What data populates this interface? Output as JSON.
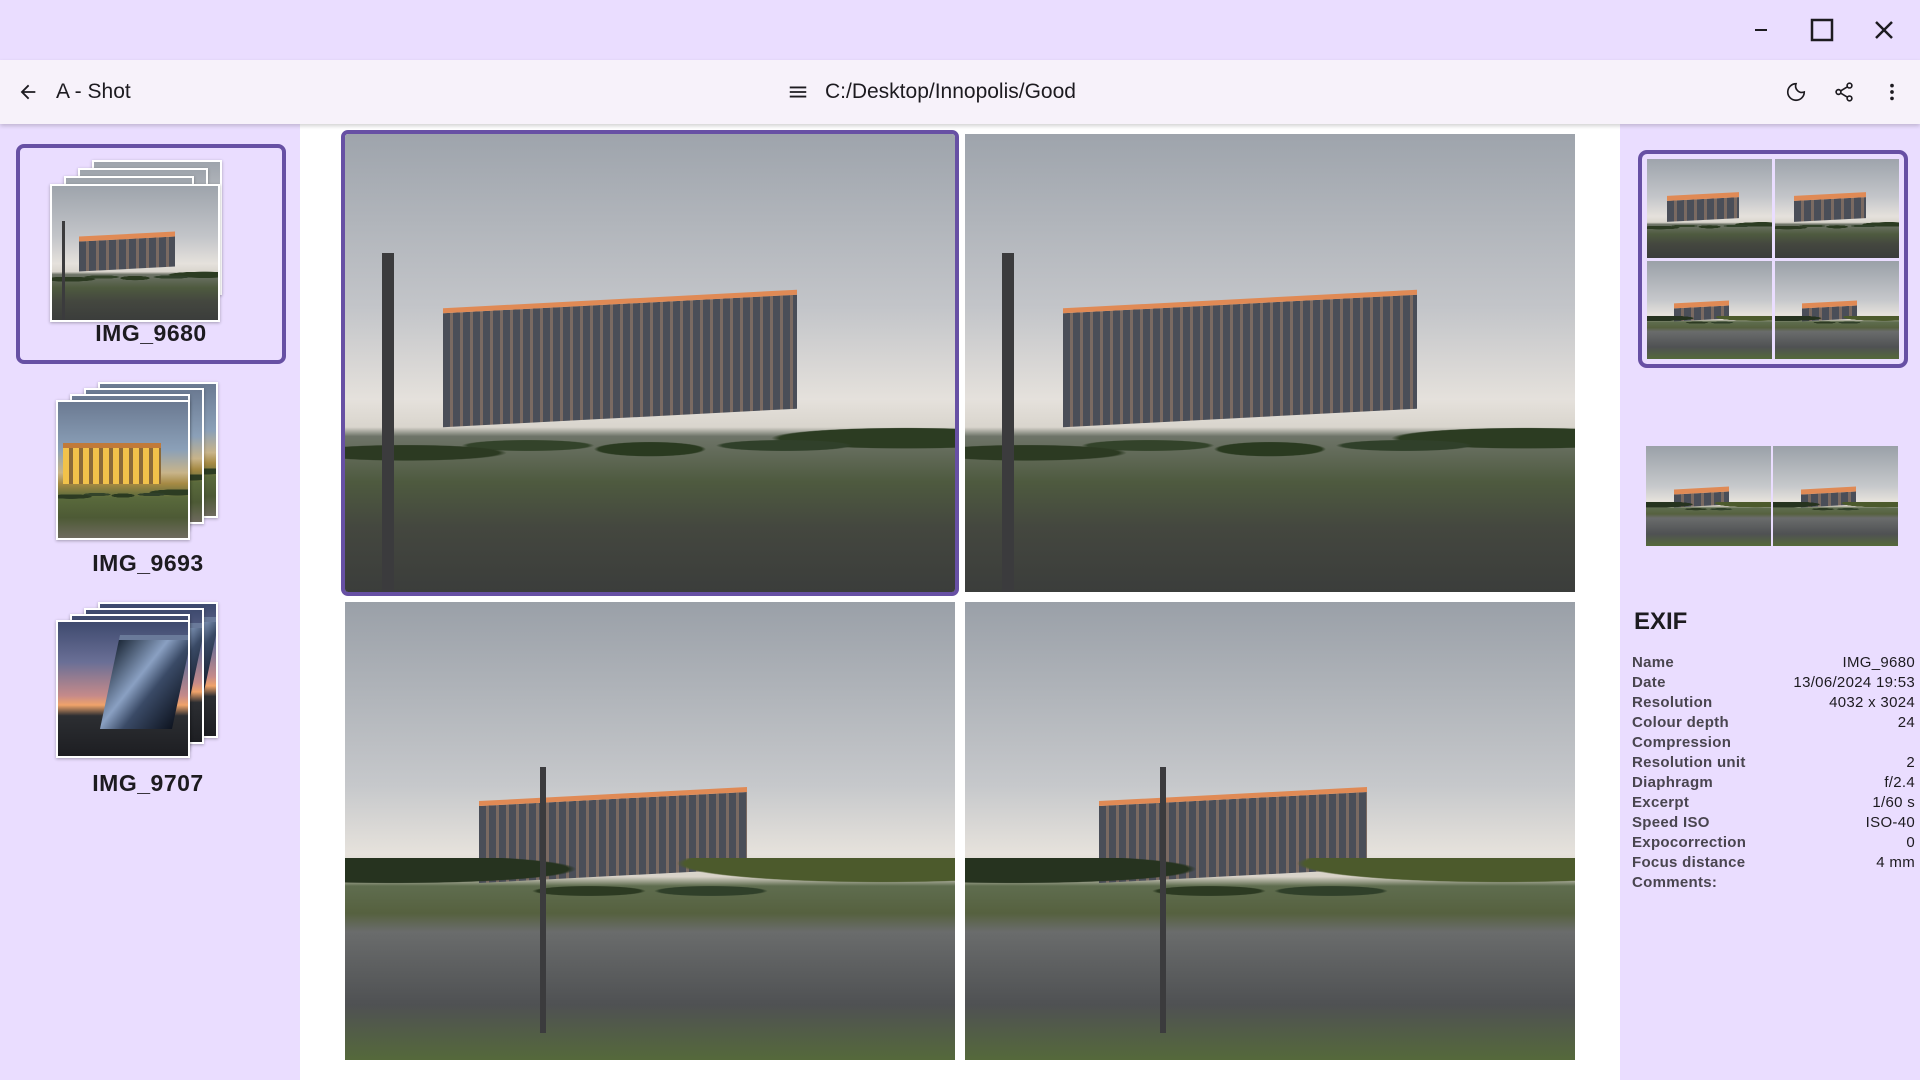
{
  "window": {
    "minimize_icon": "minimize-icon",
    "maximize_icon": "maximize-icon",
    "close_icon": "close-icon"
  },
  "toolbar": {
    "back_icon": "arrow-back-icon",
    "app_title": "A - Shot",
    "menu_icon": "hamburger-menu-icon",
    "path": "C:/Desktop/Innopolis/Good",
    "theme_icon": "dark-mode-moon-icon",
    "share_icon": "share-icon",
    "more_icon": "more-vert-icon"
  },
  "files": [
    {
      "name": "IMG_9680",
      "selected": true
    },
    {
      "name": "IMG_9693",
      "selected": false
    },
    {
      "name": "IMG_9707",
      "selected": false
    }
  ],
  "grid_photos": [
    {
      "scene": "building-front",
      "selected": true
    },
    {
      "scene": "building-front",
      "selected": false
    },
    {
      "scene": "building-road",
      "selected": false
    },
    {
      "scene": "building-road",
      "selected": false
    }
  ],
  "exif": {
    "title": "EXIF",
    "rows": [
      {
        "label": "Name",
        "value": "IMG_9680"
      },
      {
        "label": "Date",
        "value": "13/06/2024 19:53"
      },
      {
        "label": "Resolution",
        "value": "4032 x 3024"
      },
      {
        "label": "Colour depth",
        "value": "24"
      },
      {
        "label": "Compression",
        "value": ""
      },
      {
        "label": "Resolution unit",
        "value": "2"
      },
      {
        "label": "Diaphragm",
        "value": "f/2.4"
      },
      {
        "label": "Excerpt",
        "value": "1/60 s"
      },
      {
        "label": "Speed ISO",
        "value": "ISO-40"
      },
      {
        "label": "Expocorrection",
        "value": "0"
      },
      {
        "label": "Focus distance",
        "value": "4 mm"
      },
      {
        "label": "Comments:",
        "value": ""
      }
    ]
  },
  "colors": {
    "accent": "#6750a4",
    "panel_bg": "#eaddff",
    "toolbar_bg": "#f7f2fa"
  }
}
